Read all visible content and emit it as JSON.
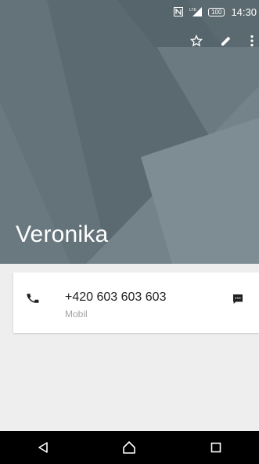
{
  "status_bar": {
    "time": "14:30",
    "battery": "100",
    "icons": [
      "nfc-icon",
      "signal-icon",
      "battery-icon"
    ]
  },
  "toolbar": {
    "actions": [
      "star-icon",
      "edit-pencil-icon",
      "more-vert-icon"
    ]
  },
  "contact": {
    "name": "Veronika"
  },
  "phone_entry": {
    "number": "+420 603 603 603",
    "type": "Mobil",
    "icons": [
      "phone-icon",
      "sms-icon"
    ]
  },
  "nav_bar": {
    "buttons": [
      "back-icon",
      "home-icon",
      "recents-icon"
    ]
  },
  "colors": {
    "header_bg": "#5b6a70",
    "page_bg": "#eeeeee",
    "card_bg": "#ffffff",
    "nav_bg": "#000000"
  }
}
